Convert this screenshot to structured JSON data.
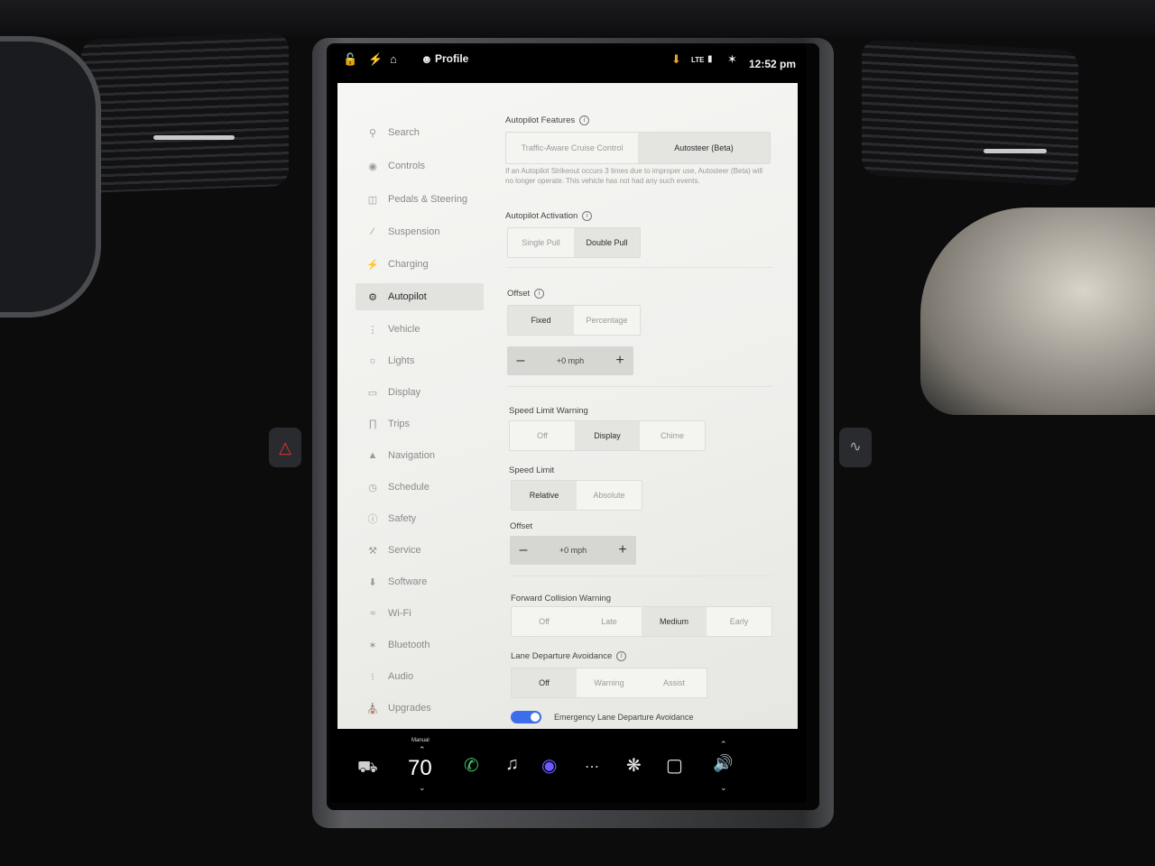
{
  "status_bar": {
    "profile_label": "Profile",
    "time": "12:52 pm",
    "network": "LTE",
    "icons": [
      "lock-icon",
      "bolt-icon",
      "home-icon",
      "person-icon",
      "download-icon",
      "signal-icon",
      "bluetooth-icon"
    ]
  },
  "sidebar": {
    "items": [
      {
        "label": "Search",
        "icon": "search-icon"
      },
      {
        "label": "Controls",
        "icon": "toggle-icon"
      },
      {
        "label": "Pedals & Steering",
        "icon": "car-icon"
      },
      {
        "label": "Suspension",
        "icon": "wrench-icon"
      },
      {
        "label": "Charging",
        "icon": "bolt-icon"
      },
      {
        "label": "Autopilot",
        "icon": "steering-wheel-icon",
        "active": true
      },
      {
        "label": "Vehicle",
        "icon": "sliders-icon"
      },
      {
        "label": "Lights",
        "icon": "sun-icon"
      },
      {
        "label": "Display",
        "icon": "screen-icon"
      },
      {
        "label": "Trips",
        "icon": "trips-icon"
      },
      {
        "label": "Navigation",
        "icon": "navigation-icon"
      },
      {
        "label": "Schedule",
        "icon": "clock-icon"
      },
      {
        "label": "Safety",
        "icon": "info-icon"
      },
      {
        "label": "Service",
        "icon": "wrench-icon"
      },
      {
        "label": "Software",
        "icon": "download-icon"
      },
      {
        "label": "Wi-Fi",
        "icon": "wifi-icon"
      },
      {
        "label": "Bluetooth",
        "icon": "bluetooth-icon"
      },
      {
        "label": "Audio",
        "icon": "audio-icon"
      },
      {
        "label": "Upgrades",
        "icon": "bag-icon"
      }
    ]
  },
  "autopilot": {
    "features": {
      "title": "Autopilot Features",
      "options": [
        "Traffic-Aware Cruise Control",
        "Autosteer (Beta)"
      ],
      "selected": "Autosteer (Beta)",
      "note": "If an Autopilot Strikeout occurs 3 times due to improper use, Autosteer (Beta) will no longer operate. This vehicle has not had any such events."
    },
    "activation": {
      "title": "Autopilot Activation",
      "options": [
        "Single Pull",
        "Double Pull"
      ],
      "selected": "Double Pull"
    },
    "offset": {
      "title": "Offset",
      "options": [
        "Fixed",
        "Percentage"
      ],
      "selected": "Fixed",
      "value": "+0 mph"
    },
    "speed_limit_warning": {
      "title": "Speed Limit Warning",
      "options": [
        "Off",
        "Display",
        "Chime"
      ],
      "selected": "Display"
    },
    "speed_limit": {
      "title": "Speed Limit",
      "options": [
        "Relative",
        "Absolute"
      ],
      "selected": "Relative"
    },
    "offset2": {
      "title": "Offset",
      "value": "+0 mph"
    },
    "forward_collision": {
      "title": "Forward Collision Warning",
      "options": [
        "Off",
        "Late",
        "Medium",
        "Early"
      ],
      "selected": "Medium"
    },
    "lane_departure": {
      "title": "Lane Departure Avoidance",
      "options": [
        "Off",
        "Warning",
        "Assist"
      ],
      "selected": "Off"
    },
    "emergency_lane": {
      "label": "Emergency Lane Departure Avoidance",
      "enabled": true
    }
  },
  "dock": {
    "climate_mode": "Manual",
    "temperature": "70",
    "icons": [
      "car-icon",
      "phone-icon",
      "music-icon",
      "camera-icon",
      "apps-icon",
      "fan-icon",
      "seat-heater-icon",
      "volume-icon"
    ],
    "colors": {
      "phone": "#3ec46d",
      "camera": "#6a5cff"
    }
  }
}
